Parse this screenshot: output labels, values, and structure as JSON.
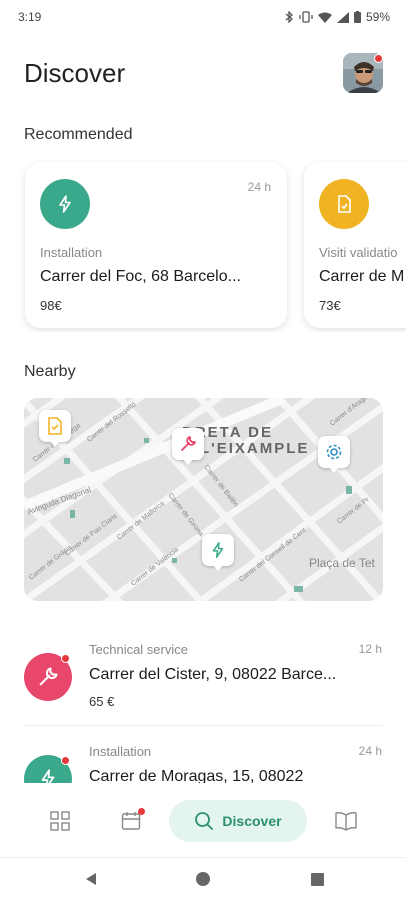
{
  "status_bar": {
    "time": "3:19",
    "battery": "59%"
  },
  "header": {
    "title": "Discover"
  },
  "recommended": {
    "label": "Recommended",
    "cards": [
      {
        "type": "Installation",
        "address": "Carrer del Foc, 68 Barcelo...",
        "price": "98€",
        "time": "24 h",
        "icon": "bolt-icon",
        "color": "#3aa88a"
      },
      {
        "type": "Visiti validatio",
        "address": "Carrer de M",
        "price": "73€",
        "time": "",
        "icon": "document-check-icon",
        "color": "#f0b323"
      }
    ]
  },
  "nearby": {
    "label": "Nearby",
    "map": {
      "district": [
        "DRETA DE",
        "L'EIXAMPLE"
      ],
      "place": "Plaça de Tet",
      "streets": [
        "Carrer del Rosselló",
        "Carrer de Còrsega",
        "Avinguda Diagonal",
        "Carrer de Pau Claris",
        "Carrer de Mallorca",
        "Carrer de València",
        "Carrer de Girona",
        "Carrer de Bailèn",
        "Carrer del Consell de Cent",
        "Carrer d'Aragó",
        "Carrer de Gràcia",
        "Carrer de Pr"
      ]
    },
    "items": [
      {
        "type": "Technical service",
        "address": "Carrer del Cister, 9, 08022 Barce...",
        "price": "65 €",
        "time": "12 h",
        "icon": "wrench-icon",
        "color": "#e8466a"
      },
      {
        "type": "Installation",
        "address": "Carrer de Moragas, 15, 08022",
        "price": "",
        "time": "24 h",
        "icon": "bolt-icon",
        "color": "#3aa88a"
      }
    ]
  },
  "bottom_nav": {
    "discover_label": "Discover"
  },
  "colors": {
    "accent": "#2c8f72",
    "accent_bg": "#e4f4ef",
    "alert": "#e5383b"
  }
}
